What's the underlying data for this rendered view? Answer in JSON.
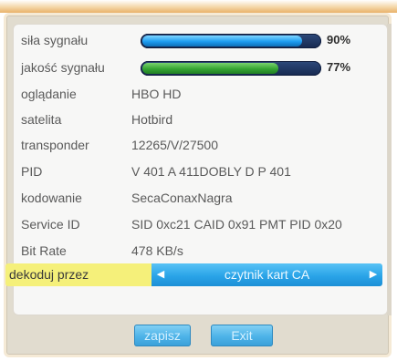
{
  "signal": {
    "strength": {
      "label": "siła sygnału",
      "percent_text": "90%",
      "percent": 90,
      "color": "#1d9cf0"
    },
    "quality": {
      "label": "jakość sygnału",
      "percent_text": "77%",
      "percent": 77,
      "color": "#35a533"
    }
  },
  "info_rows": [
    {
      "label": "oglądanie",
      "value": "HBO HD"
    },
    {
      "label": "satelita",
      "value": "Hotbird"
    },
    {
      "label": "transponder",
      "value": "12265/V/27500"
    },
    {
      "label": "PID",
      "value": "V 401  A 411DOBLY D  P 401"
    },
    {
      "label": "kodowanie",
      "value": "SecaConaxNagra"
    },
    {
      "label": "Service ID",
      "value": "SID 0xc21  CAID 0x91  PMT PID  0x20"
    },
    {
      "label": "Bit Rate",
      "value": "478 KB/s"
    }
  ],
  "decode": {
    "label": "dekoduj przez",
    "selected": "czytnik kart CA",
    "left_arrow_icon": "chevron-left-icon",
    "right_arrow_icon": "chevron-right-icon"
  },
  "buttons": {
    "save": "zapisz",
    "exit": "Exit"
  }
}
